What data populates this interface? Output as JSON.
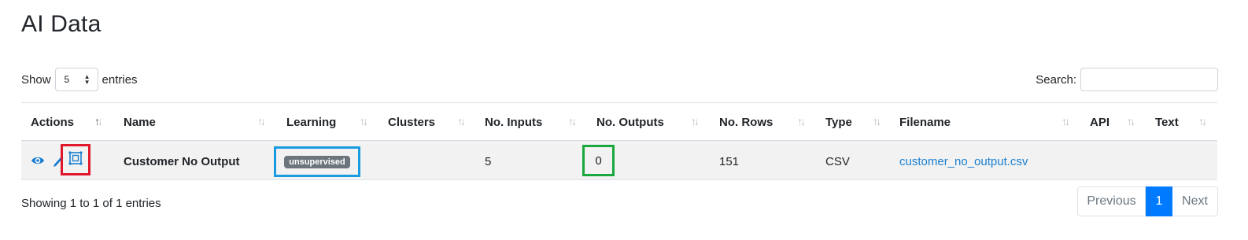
{
  "page": {
    "title": "AI Data"
  },
  "length": {
    "show_label": "Show",
    "value": "5",
    "entries_label": "entries"
  },
  "search": {
    "label": "Search:",
    "value": ""
  },
  "columns": [
    "Actions",
    "Name",
    "Learning",
    "Clusters",
    "No. Inputs",
    "No. Outputs",
    "No. Rows",
    "Type",
    "Filename",
    "API",
    "Text"
  ],
  "rows": [
    {
      "actions": [
        "eye-icon",
        "pencil-icon",
        "model-icon"
      ],
      "name": "Customer No Output",
      "learning": "unsupervised",
      "clusters": "",
      "inputs": "5",
      "outputs": "0",
      "rows": "151",
      "type": "CSV",
      "filename": "customer_no_output.csv",
      "api": "",
      "text": ""
    }
  ],
  "info": "Showing 1 to 1 of 1 entries",
  "pagination": {
    "previous": "Previous",
    "current": "1",
    "next": "Next"
  },
  "colors": {
    "link": "#1a7fd0",
    "page_active": "#007bff",
    "badge": "#6c757d",
    "highlight_red": "#e0182d",
    "highlight_blue": "#1a9be0",
    "highlight_green": "#1aa83e"
  }
}
